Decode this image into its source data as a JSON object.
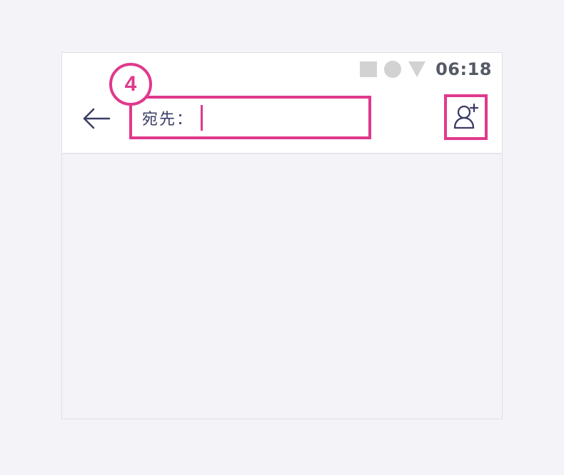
{
  "status_bar": {
    "time": "06:18",
    "icons": [
      "square-icon",
      "circle-icon",
      "triangle-icon"
    ]
  },
  "toolbar": {
    "back_icon": "arrow-left-icon",
    "to_label": "宛先：",
    "to_value": "",
    "add_contact_icon": "add-person-icon"
  },
  "annotation": {
    "step_number": "4"
  },
  "colors": {
    "highlight": "#e0398c",
    "icon": "#3a3c66",
    "status_icons": "#d2d2d2",
    "background": "#f4f3f8"
  }
}
